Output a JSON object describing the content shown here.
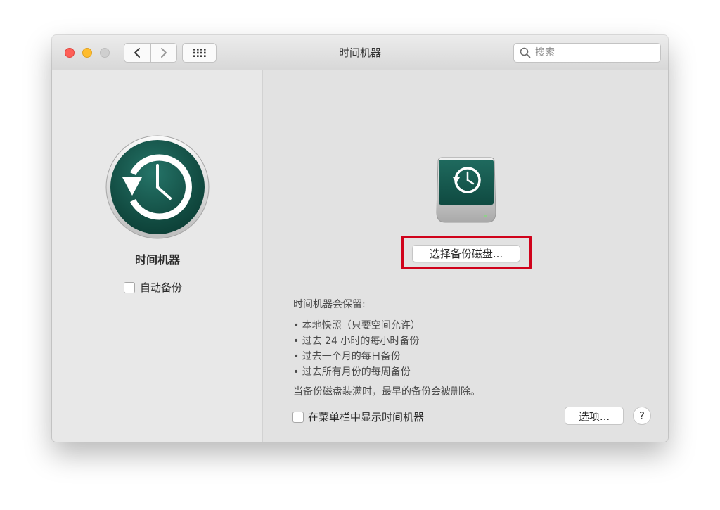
{
  "window": {
    "title": "时间机器",
    "search_placeholder": "搜索"
  },
  "sidebar": {
    "app_name": "时间机器",
    "auto_backup_label": "自动备份",
    "auto_backup_checked": false
  },
  "main": {
    "select_disk_button": "选择备份磁盘...",
    "info_heading": "时间机器会保留:",
    "info_items": [
      "本地快照（只要空间允许）",
      "过去 24 小时的每小时备份",
      "过去一个月的每日备份",
      "过去所有月份的每周备份"
    ],
    "info_note": "当备份磁盘装满时，最早的备份会被删除。",
    "show_in_menubar_label": "在菜单栏中显示时间机器",
    "show_in_menubar_checked": false,
    "options_button": "选项...",
    "help_button": "?"
  },
  "colors": {
    "time_machine_green": "#1c5e52",
    "highlight_red": "#d0021b"
  },
  "icons": [
    "back-icon",
    "forward-icon",
    "show-all-icon",
    "search-icon",
    "time-machine-icon",
    "backup-disk-icon"
  ]
}
